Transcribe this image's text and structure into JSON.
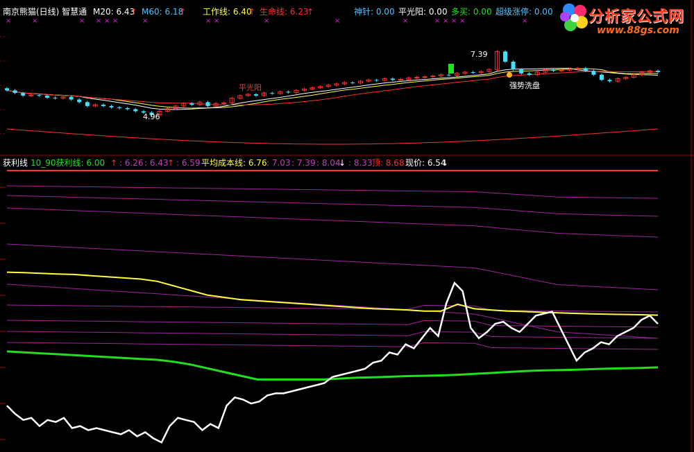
{
  "top_panel": {
    "title": "南京熊猫(日线) 智慧通",
    "indicators": [
      {
        "label": "M20: 6.43",
        "color": "#ffffff",
        "arrow": "↑"
      },
      {
        "label": "M60: 6.18",
        "color": "#ffffff",
        "arrow": "↑"
      },
      {
        "label": "工作线: 6.40",
        "color": "#ffff40",
        "arrow": "↑"
      },
      {
        "label": "生命线: 6.23",
        "color": "#ff3030",
        "arrow": "↑"
      },
      {
        "label": "神针: 0.00",
        "color": "#4fc3ff",
        "arrow": ""
      },
      {
        "label": "平光阳: 0.00",
        "color": "#ffffff",
        "arrow": ""
      },
      {
        "label": "多买: 0.00",
        "color": "#20e020",
        "arrow": ""
      },
      {
        "label": "超级涨停: 0.00",
        "color": "#4fc3ff",
        "arrow": ""
      }
    ],
    "annotations": {
      "high": "7.39",
      "low": "4.96",
      "pingguangyang": "平光阳",
      "qiangshi": "强势洗盘"
    }
  },
  "bottom_panel": {
    "title": "获利线",
    "indicators": [
      {
        "label": "10_90获利线: 6.00",
        "color": "#20e020",
        "arrow": "↑"
      },
      {
        "label": ": 6.26",
        "color": "#c040c0",
        "arrow": ""
      },
      {
        "label": ": 6.43",
        "color": "#c040c0",
        "arrow": "↑"
      },
      {
        "label": ": 6.59",
        "color": "#c040c0",
        "arrow": ""
      },
      {
        "label": "平均成本线: 6.76",
        "color": "#ffff40",
        "arrow": ""
      },
      {
        "label": ": 7.03",
        "color": "#c040c0",
        "arrow": ""
      },
      {
        "label": ": 7.39",
        "color": "#c040c0",
        "arrow": ""
      },
      {
        "label": ": 8.04",
        "color": "#c040c0",
        "arrow": "↓"
      },
      {
        "label": ": 8.33",
        "color": "#c040c0",
        "arrow": ""
      },
      {
        "label": "顶: 8.68",
        "color": "#ff3030",
        "arrow": ""
      },
      {
        "label": "现价: 6.54",
        "color": "#ffffff",
        "arrow": "↓"
      }
    ]
  },
  "logo": {
    "title": "分析家公式网",
    "url": "www.88gs.com"
  },
  "colors": {
    "up": "#ff3030",
    "down": "#40e0ff",
    "yellow": "#ffff40",
    "purple": "#a020a0",
    "green": "#20e020",
    "white": "#ffffff",
    "grid": "#8b0000"
  },
  "chart_data": {
    "type": "line",
    "price_close": [
      5.9,
      5.8,
      5.7,
      5.72,
      5.7,
      5.62,
      5.6,
      5.65,
      5.55,
      5.45,
      5.3,
      5.35,
      5.3,
      5.25,
      5.22,
      5.18,
      5.1,
      5.05,
      4.96,
      5.1,
      5.2,
      5.3,
      5.4,
      5.35,
      5.45,
      5.3,
      5.4,
      5.42,
      5.6,
      5.7,
      5.75,
      5.7,
      5.8,
      5.78,
      5.85,
      5.82,
      5.9,
      5.95,
      6.0,
      6.05,
      6.1,
      6.15,
      6.2,
      6.18,
      6.25,
      6.3,
      6.28,
      6.35,
      6.3,
      6.32,
      6.38,
      6.4,
      6.42,
      6.45,
      6.5,
      6.48,
      6.55,
      6.6,
      6.58,
      6.62,
      6.7,
      7.39,
      7.0,
      6.7,
      6.55,
      6.5,
      6.6,
      6.7,
      6.65,
      6.68,
      6.72,
      6.75,
      6.65,
      6.5,
      6.3,
      6.25,
      6.35,
      6.4,
      6.5,
      6.6,
      6.65,
      6.6
    ],
    "profit_line_white": [
      22,
      18,
      15,
      16,
      12,
      15,
      14,
      16,
      11,
      12,
      10,
      11,
      10,
      9,
      8,
      10,
      7,
      9,
      6,
      4,
      12,
      16,
      15,
      14,
      10,
      13,
      11,
      22,
      26,
      25,
      23,
      24,
      27,
      28,
      28,
      29,
      30,
      31,
      32,
      33,
      36,
      37,
      38,
      39,
      40,
      43,
      44,
      48,
      47,
      52,
      50,
      55,
      60,
      56,
      72,
      82,
      78,
      60,
      55,
      58,
      62,
      63,
      60,
      58,
      62,
      66,
      67,
      68,
      60,
      52,
      44,
      48,
      50,
      53,
      52,
      56,
      58,
      60,
      64,
      66,
      62
    ],
    "green_line": [
      53,
      52.5,
      52,
      51.5,
      51,
      50.5,
      50,
      49.5,
      49,
      48.5,
      47.5,
      46,
      44,
      42,
      40,
      38,
      38,
      38,
      38,
      38,
      38.5,
      39,
      39.2,
      39.5,
      39.8,
      40,
      40.2,
      40.5,
      41,
      41.5,
      42,
      42.5,
      42.8,
      43,
      43.2,
      43.5,
      43.8,
      44,
      44.2,
      44.5
    ],
    "yellow_line": [
      78,
      77.8,
      77.5,
      77.2,
      77,
      76.5,
      76,
      75.5,
      75,
      74,
      72,
      70,
      68,
      67,
      66,
      65.5,
      65,
      64.5,
      64,
      63.5,
      63,
      62.5,
      62,
      61.8,
      61.5,
      61,
      61,
      64,
      62,
      61.5,
      61,
      60.8,
      60.5,
      60.2,
      60,
      59.8,
      59.6,
      59.5,
      59.4,
      59.2
    ]
  }
}
